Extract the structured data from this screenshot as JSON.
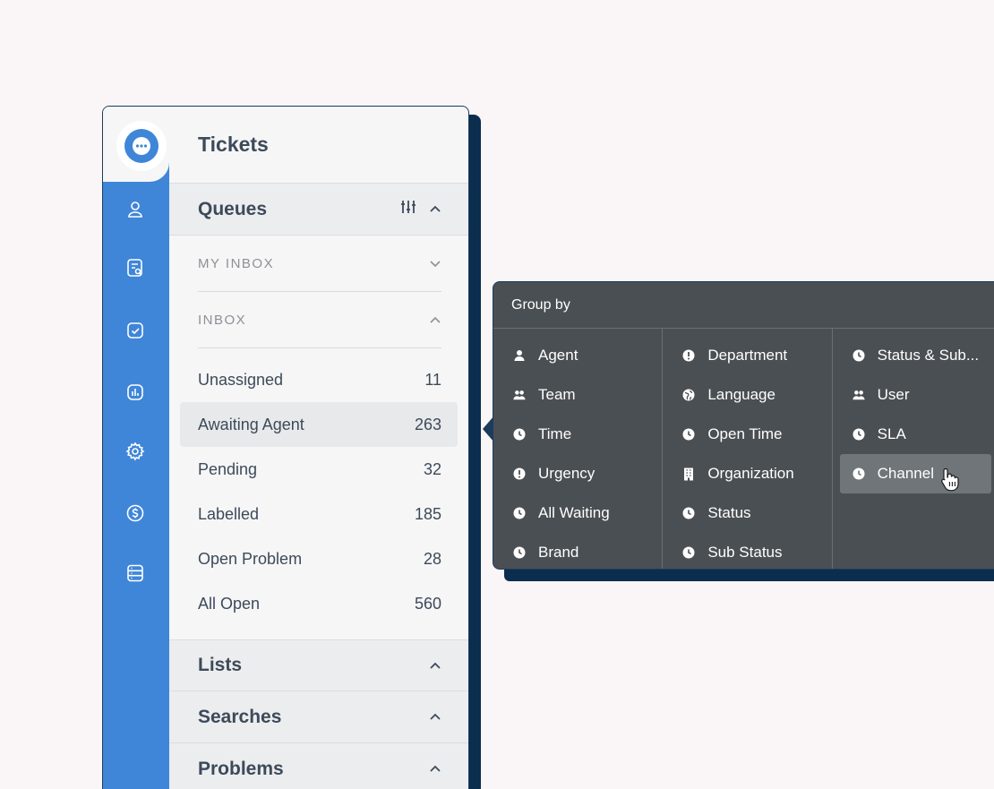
{
  "header": {
    "title": "Tickets"
  },
  "queues": {
    "label": "Queues",
    "groups": [
      {
        "label": "MY INBOX",
        "expanded": false
      },
      {
        "label": "INBOX",
        "expanded": true
      }
    ],
    "items": [
      {
        "name": "Unassigned",
        "count": "11",
        "active": false
      },
      {
        "name": "Awaiting Agent",
        "count": "263",
        "active": true
      },
      {
        "name": "Pending",
        "count": "32",
        "active": false
      },
      {
        "name": "Labelled",
        "count": "185",
        "active": false
      },
      {
        "name": "Open Problem",
        "count": "28",
        "active": false
      },
      {
        "name": "All Open",
        "count": "560",
        "active": false
      }
    ]
  },
  "sections": [
    {
      "label": "Lists"
    },
    {
      "label": "Searches"
    },
    {
      "label": "Problems"
    }
  ],
  "group_by": {
    "title": "Group by",
    "columns": [
      [
        {
          "label": "Agent",
          "icon": "person-icon"
        },
        {
          "label": "Team",
          "icon": "people-icon"
        },
        {
          "label": "Time",
          "icon": "clock-icon"
        },
        {
          "label": "Urgency",
          "icon": "exclamation-icon"
        },
        {
          "label": "All Waiting",
          "icon": "clock-icon"
        },
        {
          "label": "Brand",
          "icon": "clock-icon"
        }
      ],
      [
        {
          "label": "Department",
          "icon": "exclamation-icon"
        },
        {
          "label": "Language",
          "icon": "globe-icon"
        },
        {
          "label": "Open Time",
          "icon": "clock-icon"
        },
        {
          "label": "Organization",
          "icon": "building-icon"
        },
        {
          "label": "Status",
          "icon": "clock-icon"
        },
        {
          "label": "Sub Status",
          "icon": "clock-icon"
        }
      ],
      [
        {
          "label": "Status & Sub...",
          "icon": "clock-icon"
        },
        {
          "label": "User",
          "icon": "people-icon"
        },
        {
          "label": "SLA",
          "icon": "clock-icon"
        },
        {
          "label": "Channel",
          "icon": "clock-icon",
          "hover": true
        }
      ]
    ]
  },
  "colors": {
    "rail": "#3f86d9",
    "panel_bg": "#f6f6f7",
    "popover_bg": "#4a4f53",
    "shadow": "#0b2d4e",
    "text": "#3d4a59"
  }
}
